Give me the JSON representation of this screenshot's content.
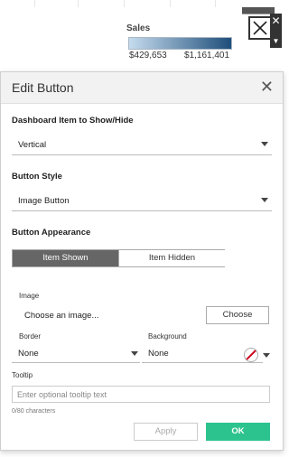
{
  "legend": {
    "title": "Sales",
    "min": "$429,653",
    "max": "$1,161,401"
  },
  "dialog": {
    "title": "Edit Button",
    "close_icon": "close-icon",
    "item_section": {
      "label": "Dashboard Item to Show/Hide",
      "value": "Vertical"
    },
    "style_section": {
      "label": "Button Style",
      "value": "Image Button"
    },
    "appearance_section": {
      "label": "Button Appearance",
      "tabs": [
        "Item Shown",
        "Item Hidden"
      ],
      "selected_tab": "Item Shown"
    },
    "image": {
      "label": "Image",
      "text": "Choose an image...",
      "button": "Choose"
    },
    "border": {
      "label": "Border",
      "value": "None"
    },
    "background": {
      "label": "Background",
      "value": "None"
    },
    "tooltip": {
      "label": "Tooltip",
      "placeholder": "Enter optional tooltip text",
      "char_count": "0/80 characters"
    },
    "buttons": {
      "apply": "Apply",
      "ok": "OK"
    }
  },
  "colors": {
    "accent_ok": "#2dc38e",
    "selected_tab": "#666666",
    "legend_start": "#c5dbee",
    "legend_end": "#1f4e7a",
    "no_color_slash": "#d0021b"
  }
}
